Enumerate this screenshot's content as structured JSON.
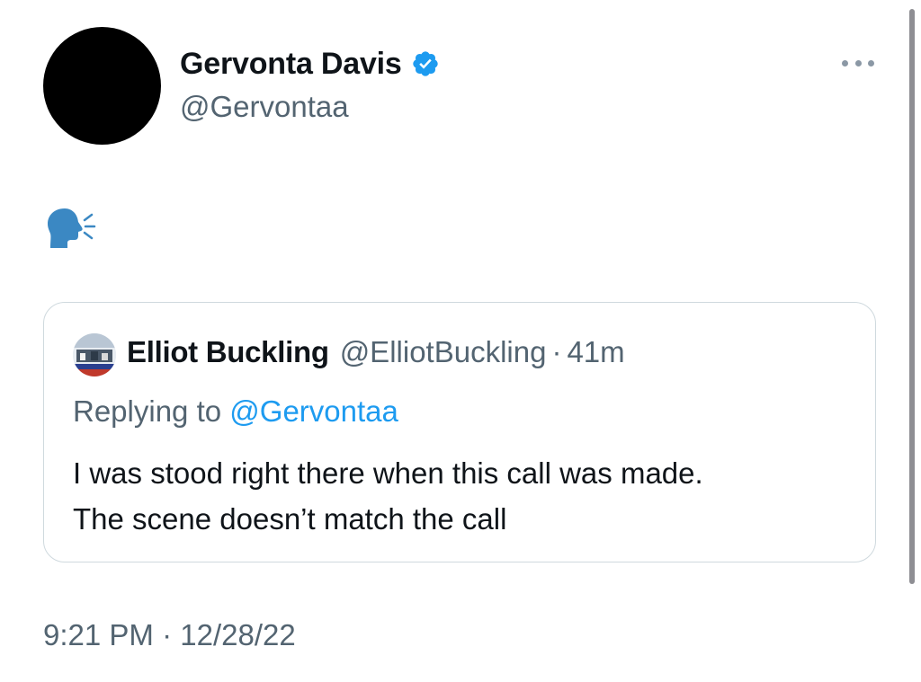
{
  "tweet": {
    "author": {
      "name": "Gervonta Davis",
      "handle": "@Gervontaa",
      "verified": true
    },
    "more_icon": "more-dots-icon",
    "text_icon": "speaking-head-icon",
    "timestamp": {
      "time": "9:21 PM",
      "separator": "·",
      "date": "12/28/22"
    }
  },
  "quote": {
    "author_name": "Elliot Buckling",
    "author_handle": "@ElliotBuckling",
    "separator": "·",
    "time_ago": "41m",
    "replying_prefix": "Replying to",
    "replying_mention": "@Gervontaa",
    "text_line1": "I was stood right there when this call was made.",
    "text_line2": "The scene doesn’t match the call"
  },
  "colors": {
    "primary_text": "#0f1419",
    "secondary_text": "#536471",
    "accent_blue": "#1d9bf0",
    "border": "#cfd9de",
    "verified_badge": "#1d9bf0",
    "emoji_head": "#3b88c3"
  }
}
